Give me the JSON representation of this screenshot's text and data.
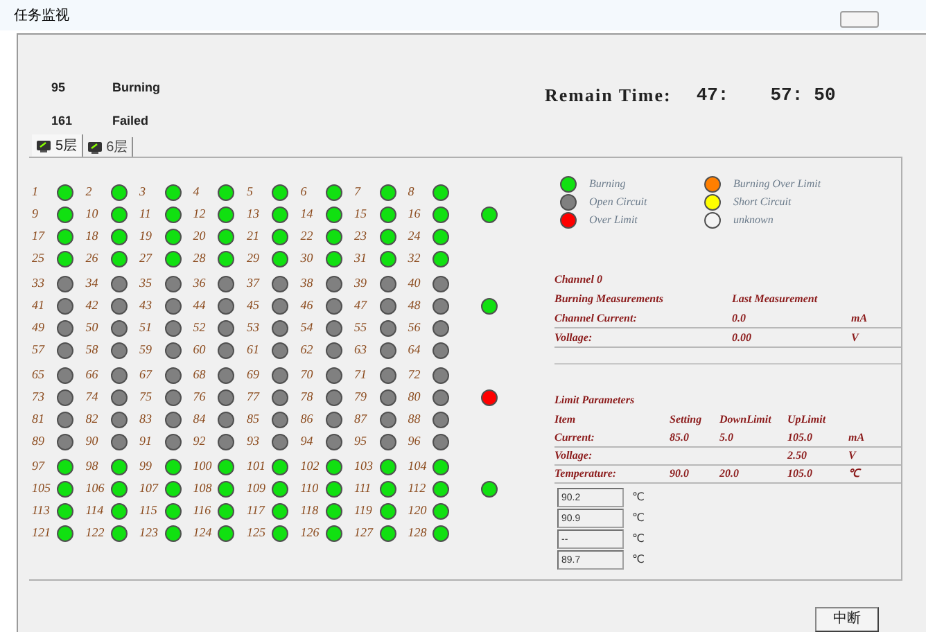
{
  "window": {
    "title": "任务监视"
  },
  "counts": [
    {
      "value": "95",
      "label": "Burning"
    },
    {
      "value": "161",
      "label": "Failed"
    }
  ],
  "remain_time": {
    "label": "Remain Time:",
    "hours": "47:",
    "minutes": "57:",
    "seconds": "50"
  },
  "tabs": [
    {
      "label": "5层",
      "selected": true
    },
    {
      "label": "6层",
      "selected": false
    }
  ],
  "blocks": [
    {
      "indicator": {
        "color": "#11e011"
      },
      "channels": [
        {
          "number": "1",
          "color": "#11e011"
        },
        {
          "number": "2",
          "color": "#11e011"
        },
        {
          "number": "3",
          "color": "#11e011"
        },
        {
          "number": "4",
          "color": "#11e011"
        },
        {
          "number": "5",
          "color": "#11e011"
        },
        {
          "number": "6",
          "color": "#11e011"
        },
        {
          "number": "7",
          "color": "#11e011"
        },
        {
          "number": "8",
          "color": "#11e011"
        },
        {
          "number": "9",
          "color": "#11e011"
        },
        {
          "number": "10",
          "color": "#11e011"
        },
        {
          "number": "11",
          "color": "#11e011"
        },
        {
          "number": "12",
          "color": "#11e011"
        },
        {
          "number": "13",
          "color": "#11e011"
        },
        {
          "number": "14",
          "color": "#11e011"
        },
        {
          "number": "15",
          "color": "#11e011"
        },
        {
          "number": "16",
          "color": "#11e011"
        },
        {
          "number": "17",
          "color": "#11e011"
        },
        {
          "number": "18",
          "color": "#11e011"
        },
        {
          "number": "19",
          "color": "#11e011"
        },
        {
          "number": "20",
          "color": "#11e011"
        },
        {
          "number": "21",
          "color": "#11e011"
        },
        {
          "number": "22",
          "color": "#11e011"
        },
        {
          "number": "23",
          "color": "#11e011"
        },
        {
          "number": "24",
          "color": "#11e011"
        },
        {
          "number": "25",
          "color": "#11e011"
        },
        {
          "number": "26",
          "color": "#11e011"
        },
        {
          "number": "27",
          "color": "#11e011"
        },
        {
          "number": "28",
          "color": "#11e011"
        },
        {
          "number": "29",
          "color": "#11e011"
        },
        {
          "number": "30",
          "color": "#11e011"
        },
        {
          "number": "31",
          "color": "#11e011"
        },
        {
          "number": "32",
          "color": "#11e011"
        }
      ]
    },
    {
      "indicator": {
        "color": "#11e011"
      },
      "channels": [
        {
          "number": "33",
          "color": "#808080"
        },
        {
          "number": "34",
          "color": "#808080"
        },
        {
          "number": "35",
          "color": "#808080"
        },
        {
          "number": "36",
          "color": "#808080"
        },
        {
          "number": "37",
          "color": "#808080"
        },
        {
          "number": "38",
          "color": "#808080"
        },
        {
          "number": "39",
          "color": "#808080"
        },
        {
          "number": "40",
          "color": "#808080"
        },
        {
          "number": "41",
          "color": "#808080"
        },
        {
          "number": "42",
          "color": "#808080"
        },
        {
          "number": "43",
          "color": "#808080"
        },
        {
          "number": "44",
          "color": "#808080"
        },
        {
          "number": "45",
          "color": "#808080"
        },
        {
          "number": "46",
          "color": "#808080"
        },
        {
          "number": "47",
          "color": "#808080"
        },
        {
          "number": "48",
          "color": "#808080"
        },
        {
          "number": "49",
          "color": "#808080"
        },
        {
          "number": "50",
          "color": "#808080"
        },
        {
          "number": "51",
          "color": "#808080"
        },
        {
          "number": "52",
          "color": "#808080"
        },
        {
          "number": "53",
          "color": "#808080"
        },
        {
          "number": "54",
          "color": "#808080"
        },
        {
          "number": "55",
          "color": "#808080"
        },
        {
          "number": "56",
          "color": "#808080"
        },
        {
          "number": "57",
          "color": "#808080"
        },
        {
          "number": "58",
          "color": "#808080"
        },
        {
          "number": "59",
          "color": "#808080"
        },
        {
          "number": "60",
          "color": "#808080"
        },
        {
          "number": "61",
          "color": "#808080"
        },
        {
          "number": "62",
          "color": "#808080"
        },
        {
          "number": "63",
          "color": "#808080"
        },
        {
          "number": "64",
          "color": "#808080"
        }
      ]
    },
    {
      "indicator": {
        "color": "#ff0000"
      },
      "channels": [
        {
          "number": "65",
          "color": "#808080"
        },
        {
          "number": "66",
          "color": "#808080"
        },
        {
          "number": "67",
          "color": "#808080"
        },
        {
          "number": "68",
          "color": "#808080"
        },
        {
          "number": "69",
          "color": "#808080"
        },
        {
          "number": "70",
          "color": "#808080"
        },
        {
          "number": "71",
          "color": "#808080"
        },
        {
          "number": "72",
          "color": "#808080"
        },
        {
          "number": "73",
          "color": "#808080"
        },
        {
          "number": "74",
          "color": "#808080"
        },
        {
          "number": "75",
          "color": "#808080"
        },
        {
          "number": "76",
          "color": "#808080"
        },
        {
          "number": "77",
          "color": "#808080"
        },
        {
          "number": "78",
          "color": "#808080"
        },
        {
          "number": "79",
          "color": "#808080"
        },
        {
          "number": "80",
          "color": "#808080"
        },
        {
          "number": "81",
          "color": "#808080"
        },
        {
          "number": "82",
          "color": "#808080"
        },
        {
          "number": "83",
          "color": "#808080"
        },
        {
          "number": "84",
          "color": "#808080"
        },
        {
          "number": "85",
          "color": "#808080"
        },
        {
          "number": "86",
          "color": "#808080"
        },
        {
          "number": "87",
          "color": "#808080"
        },
        {
          "number": "88",
          "color": "#808080"
        },
        {
          "number": "89",
          "color": "#808080"
        },
        {
          "number": "90",
          "color": "#808080"
        },
        {
          "number": "91",
          "color": "#808080"
        },
        {
          "number": "92",
          "color": "#808080"
        },
        {
          "number": "93",
          "color": "#808080"
        },
        {
          "number": "94",
          "color": "#808080"
        },
        {
          "number": "95",
          "color": "#808080"
        },
        {
          "number": "96",
          "color": "#808080"
        }
      ]
    },
    {
      "indicator": {
        "color": "#11e011"
      },
      "channels": [
        {
          "number": "97",
          "color": "#11e011"
        },
        {
          "number": "98",
          "color": "#11e011"
        },
        {
          "number": "99",
          "color": "#11e011"
        },
        {
          "number": "100",
          "color": "#11e011"
        },
        {
          "number": "101",
          "color": "#11e011"
        },
        {
          "number": "102",
          "color": "#11e011"
        },
        {
          "number": "103",
          "color": "#11e011"
        },
        {
          "number": "104",
          "color": "#11e011"
        },
        {
          "number": "105",
          "color": "#11e011"
        },
        {
          "number": "106",
          "color": "#11e011"
        },
        {
          "number": "107",
          "color": "#11e011"
        },
        {
          "number": "108",
          "color": "#11e011"
        },
        {
          "number": "109",
          "color": "#11e011"
        },
        {
          "number": "110",
          "color": "#11e011"
        },
        {
          "number": "111",
          "color": "#11e011"
        },
        {
          "number": "112",
          "color": "#11e011"
        },
        {
          "number": "113",
          "color": "#11e011"
        },
        {
          "number": "114",
          "color": "#11e011"
        },
        {
          "number": "115",
          "color": "#11e011"
        },
        {
          "number": "116",
          "color": "#11e011"
        },
        {
          "number": "117",
          "color": "#11e011"
        },
        {
          "number": "118",
          "color": "#11e011"
        },
        {
          "number": "119",
          "color": "#11e011"
        },
        {
          "number": "120",
          "color": "#11e011"
        },
        {
          "number": "121",
          "color": "#11e011"
        },
        {
          "number": "122",
          "color": "#11e011"
        },
        {
          "number": "123",
          "color": "#11e011"
        },
        {
          "number": "124",
          "color": "#11e011"
        },
        {
          "number": "125",
          "color": "#11e011"
        },
        {
          "number": "126",
          "color": "#11e011"
        },
        {
          "number": "127",
          "color": "#11e011"
        },
        {
          "number": "128",
          "color": "#11e011"
        }
      ]
    }
  ],
  "legend": [
    {
      "color": "#11e011",
      "label": "Burning"
    },
    {
      "color": "#ff7f00",
      "label": "Burning Over Limit"
    },
    {
      "color": "#808080",
      "label": "Open Circuit"
    },
    {
      "color": "#ffff00",
      "label": "Short Circuit"
    },
    {
      "color": "#ff0000",
      "label": "Over Limit"
    },
    {
      "color": "#f4f4f4",
      "label": "unknown"
    }
  ],
  "channel": {
    "title": "Channel  0",
    "headers": [
      "Burning Measurements",
      "Last Measurement"
    ],
    "rows": [
      {
        "label": "Channel Current:",
        "value": "0.0",
        "unit": "mA"
      },
      {
        "label": "Vollage:",
        "value": "0.00",
        "unit": "V"
      }
    ]
  },
  "limits": {
    "title": "Limit Parameters",
    "columns": [
      "Item",
      "Setting",
      "DownLimit",
      "UpLimit"
    ],
    "rows": [
      {
        "label": "Current:",
        "setting": "85.0",
        "down_limit": "5.0",
        "up_limit": "105.0",
        "unit": "mA"
      },
      {
        "label": "Vollage:",
        "up_limit": "2.50",
        "unit": "V"
      },
      {
        "label": "Temperature:",
        "setting": "90.0",
        "down_limit": "20.0",
        "up_limit": "105.0",
        "unit": "℃"
      }
    ]
  },
  "temperatures": [
    {
      "value": "90.2",
      "unit": "℃"
    },
    {
      "value": "90.9",
      "unit": "℃"
    },
    {
      "value": "--",
      "unit": "℃"
    },
    {
      "value": "89.7",
      "unit": "℃"
    }
  ],
  "buttons": [
    {
      "label": "中断"
    }
  ]
}
